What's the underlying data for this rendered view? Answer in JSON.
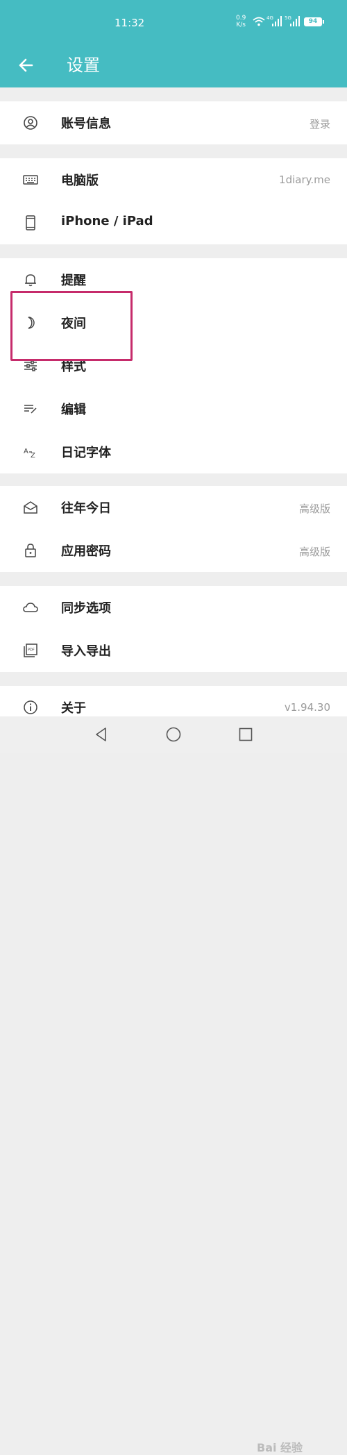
{
  "status_bar": {
    "time": "11:32",
    "speed_value": "0.9",
    "speed_unit": "K/s",
    "net_1": "4G",
    "net_2": "5G",
    "battery": "94"
  },
  "header": {
    "title": "设置"
  },
  "groups": [
    {
      "items": [
        {
          "icon": "account-icon",
          "label": "账号信息",
          "value": "登录"
        }
      ]
    },
    {
      "items": [
        {
          "icon": "keyboard-icon",
          "label": "电脑版",
          "value": "1diary.me"
        },
        {
          "icon": "phone-icon",
          "label": "iPhone / iPad",
          "value": ""
        }
      ]
    },
    {
      "items": [
        {
          "icon": "bell-icon",
          "label": "提醒",
          "value": ""
        },
        {
          "icon": "moon-icon",
          "label": "夜间",
          "value": ""
        },
        {
          "icon": "style-icon",
          "label": "样式",
          "value": ""
        },
        {
          "icon": "edit-icon",
          "label": "编辑",
          "value": ""
        },
        {
          "icon": "font-icon",
          "label": "日记字体",
          "value": ""
        }
      ]
    },
    {
      "items": [
        {
          "icon": "mail-icon",
          "label": "往年今日",
          "value": "高级版"
        },
        {
          "icon": "lock-icon",
          "label": "应用密码",
          "value": "高级版"
        }
      ]
    },
    {
      "items": [
        {
          "icon": "cloud-icon",
          "label": "同步选项",
          "value": ""
        },
        {
          "icon": "pdf-icon",
          "label": "导入导出",
          "value": ""
        }
      ]
    },
    {
      "items": [
        {
          "icon": "info-icon",
          "label": "关于",
          "value": "v1.94.30"
        }
      ]
    }
  ],
  "watermark": "Bai 经验",
  "colors": {
    "accent": "#45bcc2",
    "highlight": "#c62b6b"
  }
}
